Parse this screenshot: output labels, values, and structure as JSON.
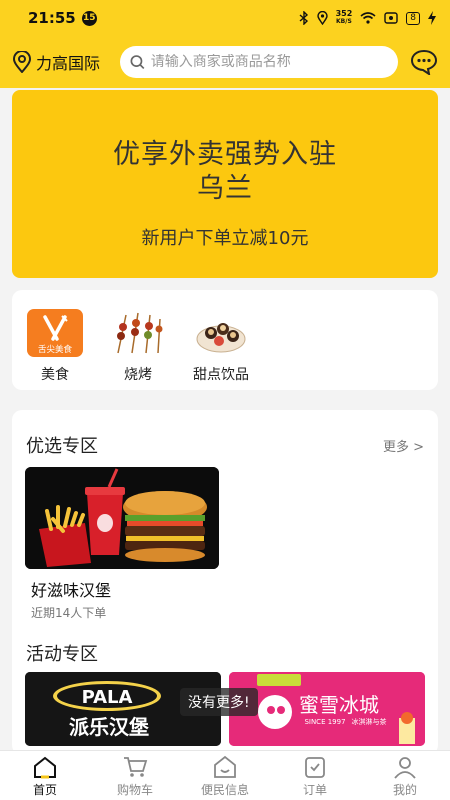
{
  "status_bar": {
    "time": "21:55",
    "notification_badge": "15",
    "net_speed_value": "352",
    "net_speed_unit": "KB/S",
    "battery": "8"
  },
  "header": {
    "location": "力高国际",
    "search_placeholder": "请输入商家或商品名称"
  },
  "banner": {
    "line1": "优享外卖强势入驻",
    "line2": "乌兰",
    "line3": "新用户下单立减10元"
  },
  "categories": [
    {
      "label": "美食",
      "icon_text": "舌尖美食",
      "icon": "food-icon"
    },
    {
      "label": "烧烤",
      "icon": "barbecue-skewer-icon"
    },
    {
      "label": "甜点饮品",
      "icon": "dessert-plate-icon"
    }
  ],
  "featured": {
    "title": "优选专区",
    "more": "更多 >",
    "items": [
      {
        "name": "好滋味汉堡",
        "sub": "近期14人下单"
      }
    ]
  },
  "activity": {
    "title": "活动专区",
    "promo1_logo": "PALA",
    "promo1_name": "派乐汉堡",
    "promo2_name": "蜜雪冰城",
    "promo2_since": "SINCE 1997",
    "promo2_slogan": "冰淇淋与茶",
    "toast": "没有更多!"
  },
  "tabbar": [
    {
      "label": "首页",
      "icon": "home-icon",
      "active": true
    },
    {
      "label": "购物车",
      "icon": "cart-icon",
      "active": false
    },
    {
      "label": "便民信息",
      "icon": "info-house-icon",
      "active": false
    },
    {
      "label": "订单",
      "icon": "order-icon",
      "active": false
    },
    {
      "label": "我的",
      "icon": "profile-icon",
      "active": false
    }
  ],
  "colors": {
    "brand_yellow": "#fcd21f",
    "banner_yellow": "#fcc80f",
    "promo_pink": "#e62a79"
  }
}
